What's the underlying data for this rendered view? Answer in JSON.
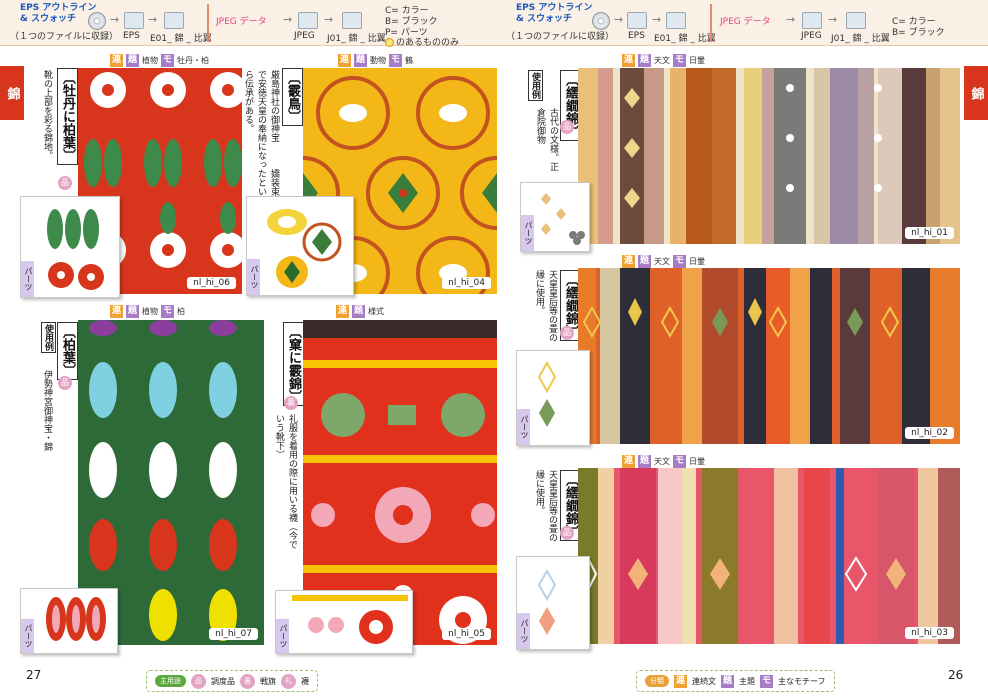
{
  "header": {
    "left": {
      "eps_label": "EPS アウトライン\n& スウォッチ",
      "eps_sub": "（１つのファイルに収録）",
      "eps_folder1": "EPS",
      "eps_folder2": "E01_ 錦 _ 比翼",
      "jpeg_label": "JPEG データ",
      "jpeg_folder1": "JPEG",
      "jpeg_folder2": "J01_ 錦 _ 比翼",
      "legend_c": "C= カラー",
      "legend_b": "B= ブラック",
      "legend_p": "P= パーツ",
      "legend_note": "のあるもののみ"
    },
    "right": {
      "eps_label": "EPS アウトライン\n& スウォッチ",
      "eps_sub": "（１つのファイルに収録）",
      "eps_folder1": "EPS",
      "eps_folder2": "E01_ 錦 _ 比翼",
      "jpeg_label": "JPEG データ",
      "jpeg_folder1": "JPEG",
      "jpeg_folder2": "J01_ 錦 _ 比翼",
      "legend_c": "C= カラー",
      "legend_b": "B= ブラック"
    }
  },
  "side_tab": "錦",
  "tags": {
    "ren": "連",
    "dai": "題",
    "mo": "モ",
    "hin": "品",
    "ji": "裏",
    "parts": "パーツ",
    "yourei": "使用例"
  },
  "entries": [
    {
      "id": "nl_hi_06",
      "code": "nl_hi_06",
      "theme": "植物",
      "motif": "牡丹・柏",
      "title": "〔牡丹に柏葉〕",
      "desc": "靴の上部を彩る錦地。"
    },
    {
      "id": "nl_hi_04",
      "code": "nl_hi_04",
      "theme": "動物",
      "motif": "鶴",
      "title": "〔霰鳥〕",
      "desc": "厳島神社の御神宝　　　嬌装束で安徳天皇の奉納になったといら伝承がある。"
    },
    {
      "id": "nl_hi_07",
      "code": "nl_hi_07",
      "theme": "植物",
      "motif": "柏",
      "title": "〔柏葉〕",
      "desc": "伊勢神宮御神宝・錦"
    },
    {
      "id": "nl_hi_05",
      "code": "nl_hi_05",
      "theme": "様式",
      "motif": "",
      "title": "〔窠に霰錦〕",
      "desc": "礼服を着用の際に用いる襪（今でいう靴下）"
    },
    {
      "id": "nl_hi_01",
      "code": "nl_hi_01",
      "theme": "天文",
      "motif": "日暈",
      "title": "〔繧繝錦〕",
      "desc": "古代の文様。正倉院御物"
    },
    {
      "id": "nl_hi_02",
      "code": "nl_hi_02",
      "theme": "天文",
      "motif": "日暈",
      "title": "〔繧繝錦〕",
      "desc": "天皇皇后等の畳の縁に使用。"
    },
    {
      "id": "nl_hi_03",
      "code": "nl_hi_03",
      "theme": "天文",
      "motif": "日暈",
      "title": "〔繧繝錦〕",
      "desc": "天皇皇后等の畳の縁に使用。"
    }
  ],
  "page_left": "27",
  "page_right": "26",
  "legend_left": {
    "label": "主用途",
    "items": [
      "品",
      "調度品",
      "裏",
      "戦旗",
      "礼",
      "襪"
    ]
  },
  "legend_right": {
    "label": "分類",
    "items": [
      "連",
      "連続文",
      "題",
      "主題",
      "モ",
      "主なモチーフ"
    ]
  },
  "colors": {
    "red": "#d7361c",
    "orange_tag": "#f0a132",
    "purple_tag": "#a77cc6",
    "header_bg": "#fbf0e6"
  }
}
